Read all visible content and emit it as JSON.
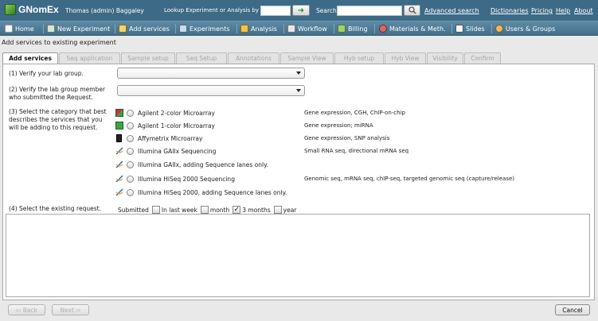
{
  "header": {
    "app_name": "GNomEx",
    "user": "Thomas (admin) Baggaley",
    "lookup_label": "Lookup Experiment or Analysis by #",
    "lookup_value": "",
    "search_label": "Search",
    "search_value": "",
    "links": [
      "Advanced search",
      "Dictionaries",
      "Pricing",
      "Help",
      "About"
    ]
  },
  "nav": {
    "items": [
      "Home",
      "New Experiment",
      "Add services",
      "Experiments",
      "Analysis",
      "Workflow",
      "Billing",
      "Materials & Meth.",
      "Slides",
      "Users & Groups"
    ]
  },
  "panel": {
    "title": "Add services to existing experiment",
    "tabs": [
      "Add services",
      "Seq application",
      "Sample setup",
      "Seq Setup",
      "Annotations",
      "Sample View",
      "Hyb setup",
      "Hyb View",
      "Visibility",
      "Confirm"
    ],
    "active_tab": "Add services"
  },
  "form": {
    "step1_label": "(1) Verify your lab group.",
    "step1_value": "",
    "step2_label_line1": "(2) Verify the lab group member",
    "step2_label_line2": "who submitted the Request.",
    "step2_value": "",
    "step3_label_line1": "(3) Select the category that best",
    "step3_label_line2": "describes the services that you",
    "step3_label_line3": "will be adding to this request.",
    "categories": [
      {
        "label": "Agilent 2-color Microarray",
        "desc": "Gene expression, CGH, ChIP-on-chip",
        "icon": "agilent-2color-icon",
        "selected": false
      },
      {
        "label": "Agilent 1-color Microarray",
        "desc": "Gene expression; miRNA",
        "icon": "agilent-1color-icon",
        "selected": false
      },
      {
        "label": "Affymetrix Microarray",
        "desc": "Gene expression, SNP analysis",
        "icon": "affymetrix-icon",
        "selected": false
      },
      {
        "label": "Illumina GAIIx Sequencing",
        "desc": "Small RNA seq, directional mRNA seq",
        "icon": "dna-icon",
        "selected": false
      },
      {
        "label": "Illumina GAIIx, adding Sequence lanes only.",
        "desc": "",
        "icon": "dna-icon",
        "selected": false
      },
      {
        "label": "Illumina HiSeq 2000 Sequencing",
        "desc": "Genomic seq, mRNA seq, chIP-seq, targeted genomic seq (capture/release)",
        "icon": "dna-icon",
        "selected": false
      },
      {
        "label": "Illumina HiSeq 2000, adding Sequence lanes only.",
        "desc": "",
        "icon": "dna-icon",
        "selected": false
      }
    ],
    "step4_label": "(4) Select the existing request.",
    "submitted_label": "Submitted",
    "filters": [
      {
        "label": "In last week",
        "checked": false
      },
      {
        "label": "month",
        "checked": false
      },
      {
        "label": "3 months",
        "checked": true
      },
      {
        "label": "year",
        "checked": false
      }
    ]
  },
  "footer": {
    "back_label": "⇦ Back",
    "next_label": "Next ⇨",
    "cancel_label": "Cancel"
  },
  "colors": {
    "header_bg": "#3d6a86",
    "nav_bg": "#4f7c98",
    "panel_bg": "#ffffff"
  }
}
